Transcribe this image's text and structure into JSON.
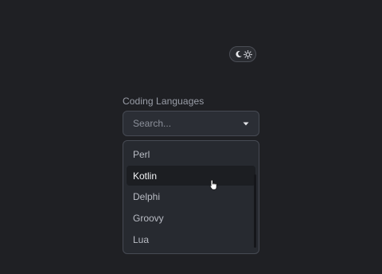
{
  "theme_toggle": {
    "moon_icon": "moon-icon",
    "sun_icon": "sun-icon"
  },
  "field": {
    "label": "Coding Languages",
    "placeholder": "Search...",
    "value": "",
    "caret_icon": "caret-down-icon"
  },
  "dropdown": {
    "options": [
      {
        "label": "Perl"
      },
      {
        "label": "Kotlin"
      },
      {
        "label": "Delphi"
      },
      {
        "label": "Groovy"
      },
      {
        "label": "Lua"
      }
    ],
    "highlighted": "Kotlin"
  },
  "colors": {
    "background": "#1f2024",
    "surface": "#2b2e35",
    "border": "#464a53",
    "highlight": "#1c1e22",
    "text": "#b9bcc4"
  }
}
